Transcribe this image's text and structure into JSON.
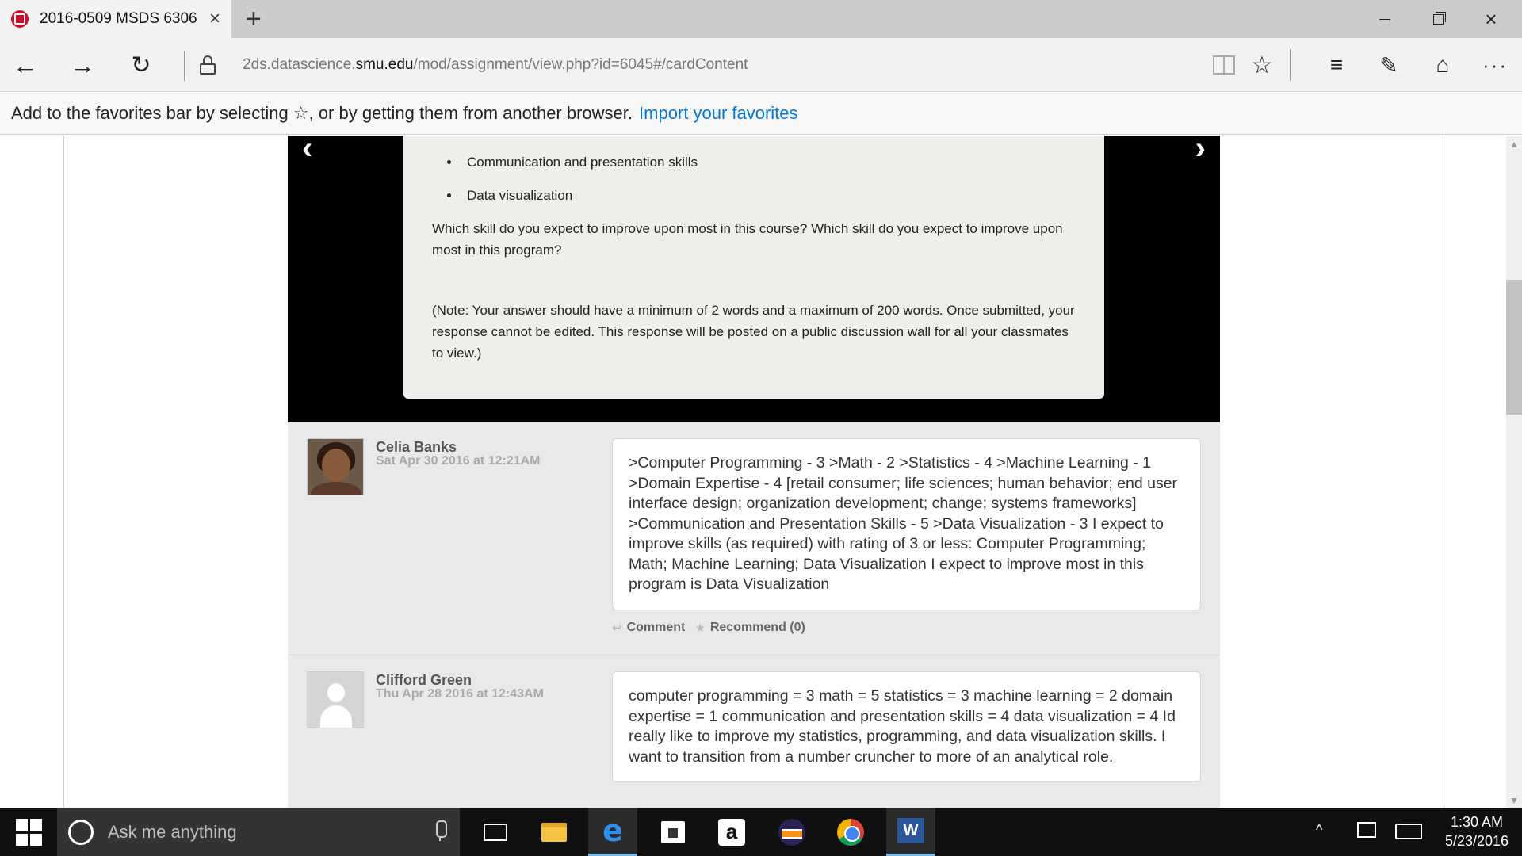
{
  "browser": {
    "tab_title": "2016-0509 MSDS 6306",
    "tab_close": "×",
    "new_tab": "+",
    "window_close": "×",
    "url_prefix": "2ds.datascience.",
    "url_domain": "smu.edu",
    "url_path": "/mod/assignment/view.php?id=6045#/cardContent",
    "nav_back": "←",
    "nav_forward": "→",
    "nav_refresh": "↻",
    "star": "☆",
    "hub": "≡",
    "notes": "✎",
    "share": "⌂",
    "more": "···"
  },
  "favorites_bar": {
    "message": "Add to the favorites bar by selecting ☆, or by getting them from another browser.",
    "link": "Import your favorites"
  },
  "card": {
    "arrow_prev": "‹",
    "arrow_next": "›",
    "bullets": [
      "Communication and presentation skills",
      "Data visualization"
    ],
    "question": "Which skill do you expect to improve upon most in this course? Which skill do you expect to improve upon most in this program?",
    "note": "(Note: Your answer should have a minimum of 2 words and a maximum of 200 words. Once submitted, your response cannot be edited. This response will be posted on a public discussion wall for all your classmates to view.)"
  },
  "posts": [
    {
      "author": "Celia Banks",
      "date": "Sat Apr 30 2016 at 12:21AM",
      "body": ">Computer Programming - 3 >Math - 2 >Statistics - 4 >Machine Learning - 1 >Domain Expertise - 4 [retail consumer; life sciences; human behavior; end user interface design; organization development; change; systems frameworks] >Communication and Presentation Skills - 5 >Data Visualization - 3 I expect to improve skills (as required) with rating of 3 or less: Computer Programming; Math; Machine Learning; Data Visualization I expect to improve most in this program is Data Visualization",
      "comment_label": "Comment",
      "recommend_label": "Recommend (0)"
    },
    {
      "author": "Clifford Green",
      "date": "Thu Apr 28 2016 at 12:43AM",
      "body": "computer programming = 3 math = 5 statistics = 3 machine learning = 2 domain expertise = 1 communication and presentation skills = 4 data visualization = 4 Id really like to improve my statistics, programming, and data visualization skills. I want to transition from a number cruncher to more of an analytical role."
    }
  ],
  "taskbar": {
    "search_placeholder": "Ask me anything",
    "amazon_letter": "a",
    "word_letter": "W",
    "tray_up": "^",
    "time": "1:30 AM",
    "date": "5/23/2016"
  },
  "colors": {
    "link_blue": "#0078d7",
    "favicon_red": "#c8102e",
    "taskbar_bg": "#101010"
  }
}
